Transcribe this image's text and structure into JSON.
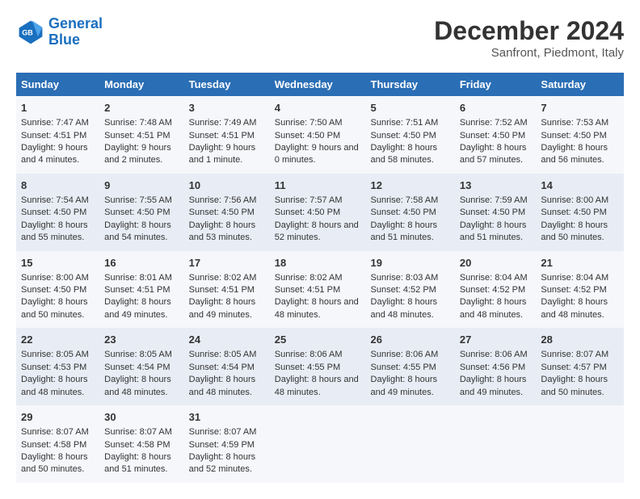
{
  "logo": {
    "line1": "General",
    "line2": "Blue"
  },
  "title": "December 2024",
  "subtitle": "Sanfront, Piedmont, Italy",
  "weekdays": [
    "Sunday",
    "Monday",
    "Tuesday",
    "Wednesday",
    "Thursday",
    "Friday",
    "Saturday"
  ],
  "weeks": [
    [
      {
        "day": "1",
        "rise": "Sunrise: 7:47 AM",
        "set": "Sunset: 4:51 PM",
        "daylight": "Daylight: 9 hours and 4 minutes."
      },
      {
        "day": "2",
        "rise": "Sunrise: 7:48 AM",
        "set": "Sunset: 4:51 PM",
        "daylight": "Daylight: 9 hours and 2 minutes."
      },
      {
        "day": "3",
        "rise": "Sunrise: 7:49 AM",
        "set": "Sunset: 4:51 PM",
        "daylight": "Daylight: 9 hours and 1 minute."
      },
      {
        "day": "4",
        "rise": "Sunrise: 7:50 AM",
        "set": "Sunset: 4:50 PM",
        "daylight": "Daylight: 9 hours and 0 minutes."
      },
      {
        "day": "5",
        "rise": "Sunrise: 7:51 AM",
        "set": "Sunset: 4:50 PM",
        "daylight": "Daylight: 8 hours and 58 minutes."
      },
      {
        "day": "6",
        "rise": "Sunrise: 7:52 AM",
        "set": "Sunset: 4:50 PM",
        "daylight": "Daylight: 8 hours and 57 minutes."
      },
      {
        "day": "7",
        "rise": "Sunrise: 7:53 AM",
        "set": "Sunset: 4:50 PM",
        "daylight": "Daylight: 8 hours and 56 minutes."
      }
    ],
    [
      {
        "day": "8",
        "rise": "Sunrise: 7:54 AM",
        "set": "Sunset: 4:50 PM",
        "daylight": "Daylight: 8 hours and 55 minutes."
      },
      {
        "day": "9",
        "rise": "Sunrise: 7:55 AM",
        "set": "Sunset: 4:50 PM",
        "daylight": "Daylight: 8 hours and 54 minutes."
      },
      {
        "day": "10",
        "rise": "Sunrise: 7:56 AM",
        "set": "Sunset: 4:50 PM",
        "daylight": "Daylight: 8 hours and 53 minutes."
      },
      {
        "day": "11",
        "rise": "Sunrise: 7:57 AM",
        "set": "Sunset: 4:50 PM",
        "daylight": "Daylight: 8 hours and 52 minutes."
      },
      {
        "day": "12",
        "rise": "Sunrise: 7:58 AM",
        "set": "Sunset: 4:50 PM",
        "daylight": "Daylight: 8 hours and 51 minutes."
      },
      {
        "day": "13",
        "rise": "Sunrise: 7:59 AM",
        "set": "Sunset: 4:50 PM",
        "daylight": "Daylight: 8 hours and 51 minutes."
      },
      {
        "day": "14",
        "rise": "Sunrise: 8:00 AM",
        "set": "Sunset: 4:50 PM",
        "daylight": "Daylight: 8 hours and 50 minutes."
      }
    ],
    [
      {
        "day": "15",
        "rise": "Sunrise: 8:00 AM",
        "set": "Sunset: 4:50 PM",
        "daylight": "Daylight: 8 hours and 50 minutes."
      },
      {
        "day": "16",
        "rise": "Sunrise: 8:01 AM",
        "set": "Sunset: 4:51 PM",
        "daylight": "Daylight: 8 hours and 49 minutes."
      },
      {
        "day": "17",
        "rise": "Sunrise: 8:02 AM",
        "set": "Sunset: 4:51 PM",
        "daylight": "Daylight: 8 hours and 49 minutes."
      },
      {
        "day": "18",
        "rise": "Sunrise: 8:02 AM",
        "set": "Sunset: 4:51 PM",
        "daylight": "Daylight: 8 hours and 48 minutes."
      },
      {
        "day": "19",
        "rise": "Sunrise: 8:03 AM",
        "set": "Sunset: 4:52 PM",
        "daylight": "Daylight: 8 hours and 48 minutes."
      },
      {
        "day": "20",
        "rise": "Sunrise: 8:04 AM",
        "set": "Sunset: 4:52 PM",
        "daylight": "Daylight: 8 hours and 48 minutes."
      },
      {
        "day": "21",
        "rise": "Sunrise: 8:04 AM",
        "set": "Sunset: 4:52 PM",
        "daylight": "Daylight: 8 hours and 48 minutes."
      }
    ],
    [
      {
        "day": "22",
        "rise": "Sunrise: 8:05 AM",
        "set": "Sunset: 4:53 PM",
        "daylight": "Daylight: 8 hours and 48 minutes."
      },
      {
        "day": "23",
        "rise": "Sunrise: 8:05 AM",
        "set": "Sunset: 4:54 PM",
        "daylight": "Daylight: 8 hours and 48 minutes."
      },
      {
        "day": "24",
        "rise": "Sunrise: 8:05 AM",
        "set": "Sunset: 4:54 PM",
        "daylight": "Daylight: 8 hours and 48 minutes."
      },
      {
        "day": "25",
        "rise": "Sunrise: 8:06 AM",
        "set": "Sunset: 4:55 PM",
        "daylight": "Daylight: 8 hours and 48 minutes."
      },
      {
        "day": "26",
        "rise": "Sunrise: 8:06 AM",
        "set": "Sunset: 4:55 PM",
        "daylight": "Daylight: 8 hours and 49 minutes."
      },
      {
        "day": "27",
        "rise": "Sunrise: 8:06 AM",
        "set": "Sunset: 4:56 PM",
        "daylight": "Daylight: 8 hours and 49 minutes."
      },
      {
        "day": "28",
        "rise": "Sunrise: 8:07 AM",
        "set": "Sunset: 4:57 PM",
        "daylight": "Daylight: 8 hours and 50 minutes."
      }
    ],
    [
      {
        "day": "29",
        "rise": "Sunrise: 8:07 AM",
        "set": "Sunset: 4:58 PM",
        "daylight": "Daylight: 8 hours and 50 minutes."
      },
      {
        "day": "30",
        "rise": "Sunrise: 8:07 AM",
        "set": "Sunset: 4:58 PM",
        "daylight": "Daylight: 8 hours and 51 minutes."
      },
      {
        "day": "31",
        "rise": "Sunrise: 8:07 AM",
        "set": "Sunset: 4:59 PM",
        "daylight": "Daylight: 8 hours and 52 minutes."
      },
      null,
      null,
      null,
      null
    ]
  ]
}
